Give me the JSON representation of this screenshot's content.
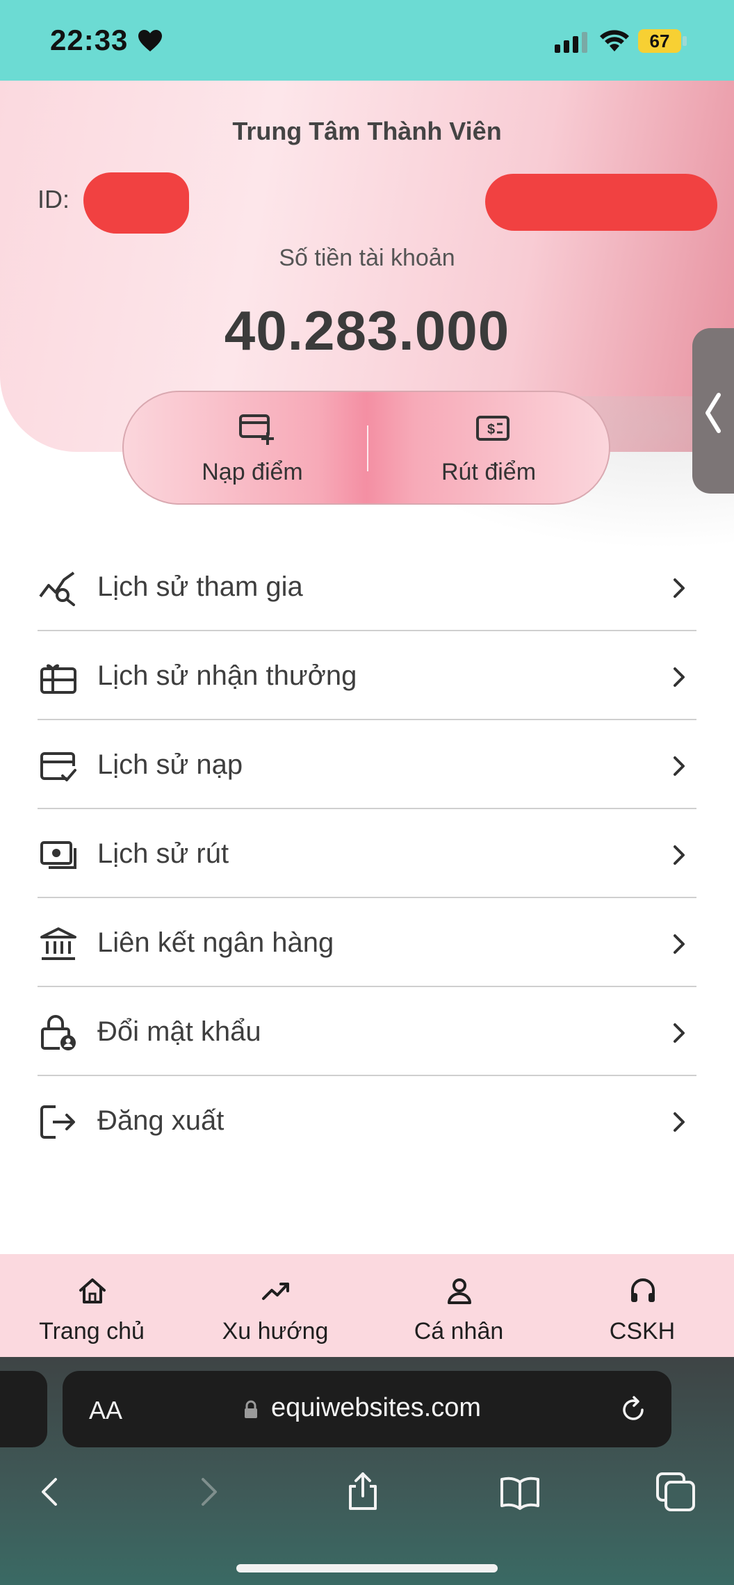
{
  "status_bar": {
    "time": "22:33",
    "battery": "67"
  },
  "header": {
    "title": "Trung Tâm Thành Viên",
    "id_label": "ID:",
    "balance_label": "Số tiền tài khoản",
    "balance_value": "40.283.000"
  },
  "actions": {
    "deposit": "Nạp điểm",
    "withdraw": "Rút điểm"
  },
  "menu": {
    "items": [
      {
        "label": "Lịch sử tham gia",
        "icon": "chart-search-icon"
      },
      {
        "label": "Lịch sử nhận thưởng",
        "icon": "gift-card-icon"
      },
      {
        "label": "Lịch sử nạp",
        "icon": "card-check-icon"
      },
      {
        "label": "Lịch sử rút",
        "icon": "cash-icon"
      },
      {
        "label": "Liên kết ngân hàng",
        "icon": "bank-icon"
      },
      {
        "label": "Đổi mật khẩu",
        "icon": "lock-user-icon"
      },
      {
        "label": "Đăng xuất",
        "icon": "logout-icon"
      }
    ]
  },
  "bottom_nav": {
    "home": "Trang chủ",
    "trends": "Xu hướng",
    "profile": "Cá nhân",
    "support": "CSKH"
  },
  "browser": {
    "aa": "AA",
    "url": "equiwebsites.com"
  },
  "colors": {
    "status_bar": "#6cdbd3",
    "header_pink": "#fbd9df",
    "accent_pink": "#f48fa3",
    "redaction": "#f14141"
  }
}
